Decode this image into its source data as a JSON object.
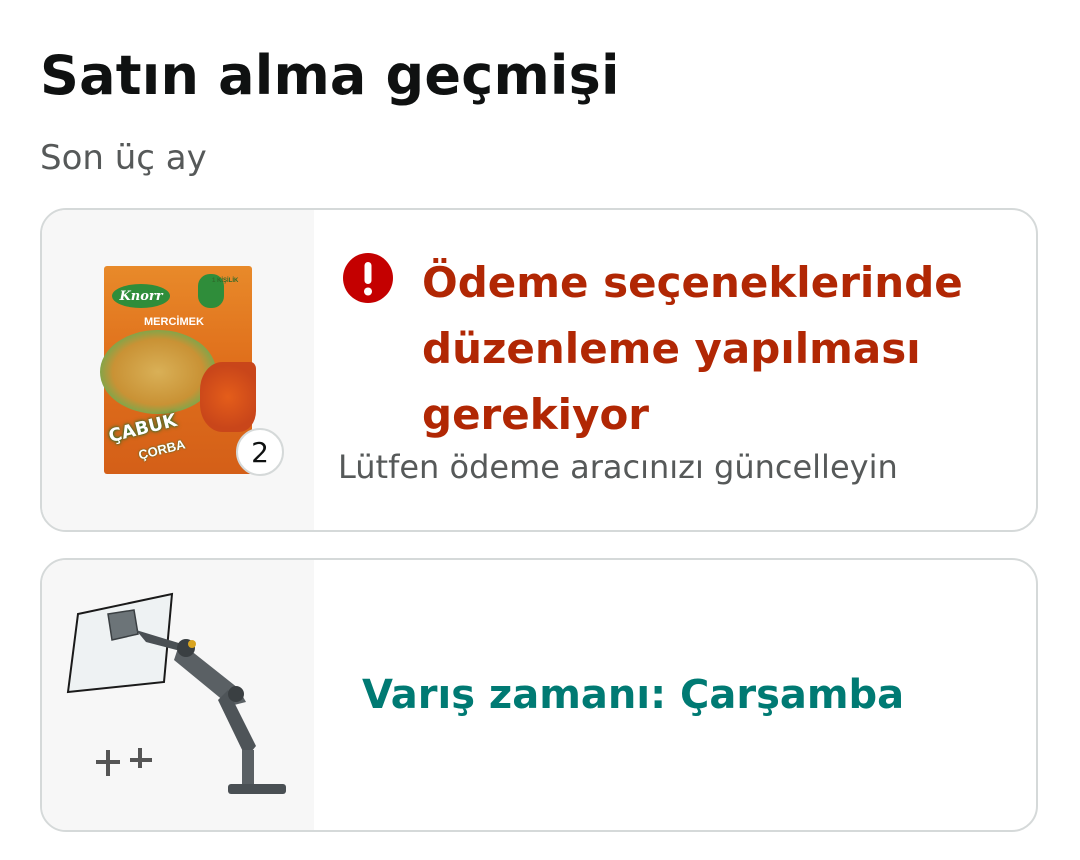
{
  "page": {
    "title": "Satın alma geçmişi",
    "subtitle": "Son üç ay"
  },
  "orders": [
    {
      "image": "knorr-mercimek-soup-packet",
      "quantity": "2",
      "status_icon": "exclamation-circle-icon",
      "status_title": "Ödeme seçeneklerinde düzenleme yapılması gerekiyor",
      "status_detail": "Lütfen ödeme aracınızı güncelleyin",
      "status_color": "#b12704"
    },
    {
      "image": "monitor-arm-mount",
      "status_title": "Varış zamanı: Çarşamba",
      "status_color": "#007a73"
    }
  ],
  "packet_art": {
    "brand_logo": "Knorr",
    "variant": "MERCİMEK",
    "brand_line1": "ÇABUK",
    "brand_line2": "ÇORBA",
    "seal_text": "1 KİŞİLİK"
  },
  "colors": {
    "alert": "#b12704",
    "arrival": "#007a73",
    "border": "#d5d9d9",
    "muted": "#565959"
  }
}
